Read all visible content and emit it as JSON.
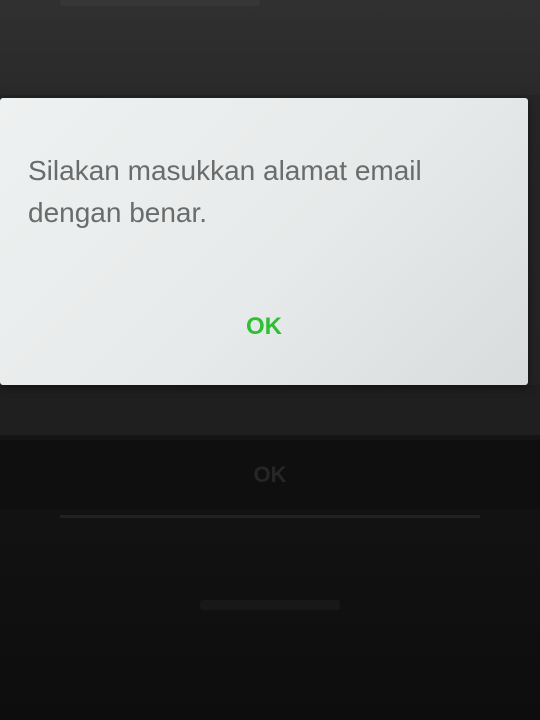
{
  "dialog": {
    "message": "Silakan masukkan alamat email dengan benar.",
    "ok_label": "OK",
    "ok_color": "#2fbf34"
  },
  "background": {
    "ok_label": "OK"
  }
}
